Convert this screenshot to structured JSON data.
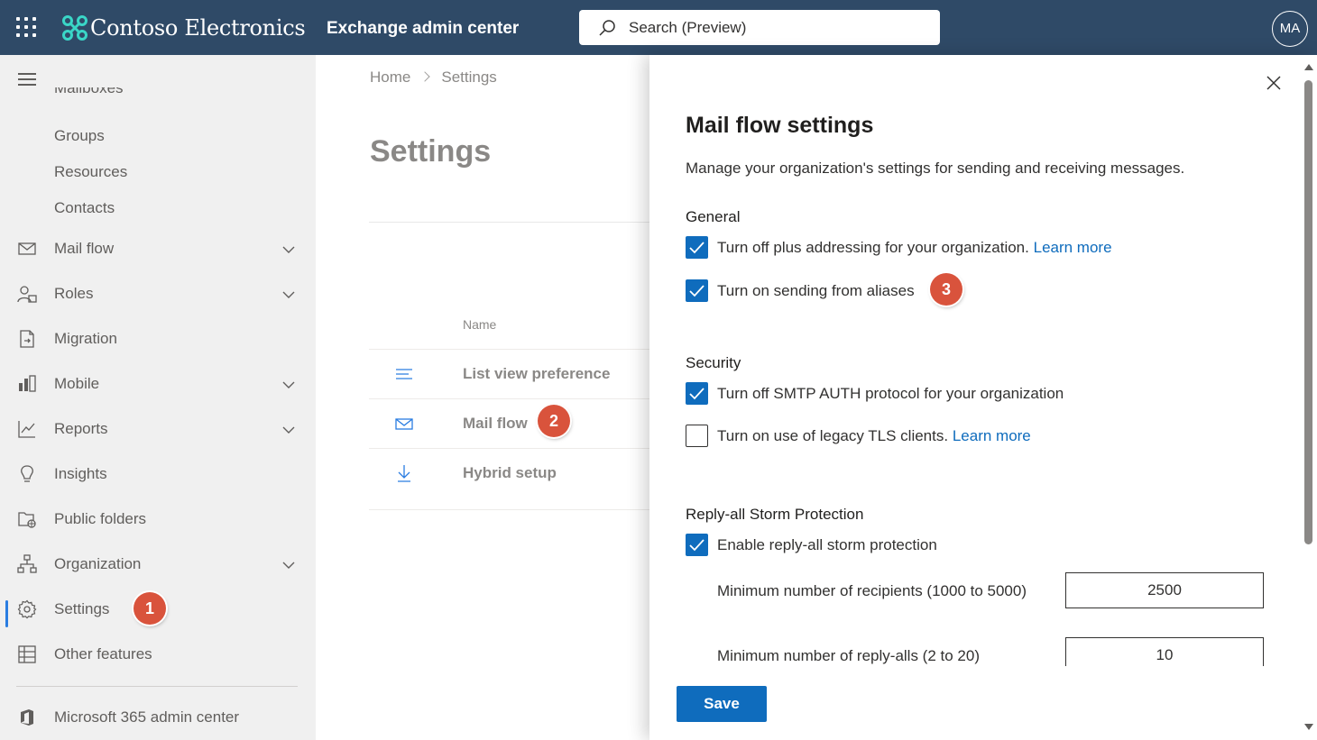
{
  "header": {
    "brand": "Contoso Electronics",
    "app_title": "Exchange admin center",
    "search_placeholder": "Search (Preview)",
    "avatar_initials": "MA",
    "bar_color": "#2f4a67"
  },
  "sidebar": {
    "partial_item": "Mailboxes",
    "sub_items": [
      "Groups",
      "Resources",
      "Contacts"
    ],
    "items": [
      {
        "label": "Mail flow",
        "icon": "mail-icon",
        "expandable": true
      },
      {
        "label": "Roles",
        "icon": "roles-icon",
        "expandable": true
      },
      {
        "label": "Migration",
        "icon": "migration-icon",
        "expandable": false
      },
      {
        "label": "Mobile",
        "icon": "mobile-icon",
        "expandable": true
      },
      {
        "label": "Reports",
        "icon": "reports-icon",
        "expandable": true
      },
      {
        "label": "Insights",
        "icon": "lightbulb-icon",
        "expandable": false
      },
      {
        "label": "Public folders",
        "icon": "public-folders-icon",
        "expandable": false
      },
      {
        "label": "Organization",
        "icon": "organization-icon",
        "expandable": true
      },
      {
        "label": "Settings",
        "icon": "gear-icon",
        "expandable": false,
        "selected": true
      },
      {
        "label": "Other features",
        "icon": "grid-icon",
        "expandable": false
      }
    ],
    "footer_link": "Microsoft 365 admin center"
  },
  "breadcrumb": {
    "home": "Home",
    "current": "Settings"
  },
  "page": {
    "title": "Settings",
    "column_name": "Name",
    "rows": [
      "List view preference",
      "Mail flow",
      "Hybrid setup"
    ]
  },
  "badges": {
    "one": "1",
    "two": "2",
    "three": "3"
  },
  "panel": {
    "title": "Mail flow settings",
    "description": "Manage your organization's settings for sending and receiving messages.",
    "general": {
      "heading": "General",
      "plus_addressing": {
        "label": "Turn off plus addressing for your organization.",
        "link": "Learn more",
        "checked": true
      },
      "send_from_aliases": {
        "label": "Turn on sending from aliases",
        "checked": true
      }
    },
    "security": {
      "heading": "Security",
      "smtp_auth": {
        "label": "Turn off SMTP AUTH protocol for your organization",
        "checked": true
      },
      "legacy_tls": {
        "label": "Turn on use of legacy TLS clients.",
        "link": "Learn more",
        "checked": false
      }
    },
    "reply_all": {
      "heading": "Reply-all Storm Protection",
      "enable": {
        "label": "Enable reply-all storm protection",
        "checked": true
      },
      "min_recipients": {
        "label": "Minimum number of recipients (1000 to 5000)",
        "value": "2500"
      },
      "min_reply_alls": {
        "label": "Minimum number of reply-alls (2 to 20)",
        "value": "10"
      }
    },
    "save_label": "Save"
  }
}
